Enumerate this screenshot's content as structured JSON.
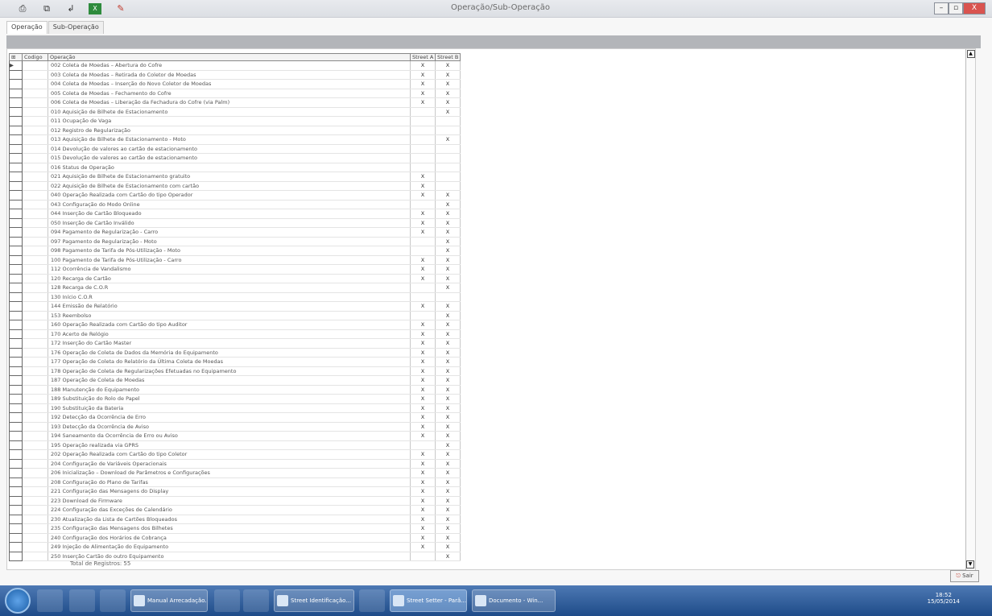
{
  "window": {
    "title": "Operação/Sub-Operação",
    "toolbar_icons": [
      "print-icon",
      "copy-icon",
      "export-icon",
      "excel-icon",
      "pdf-icon"
    ],
    "controls": {
      "minimize": "–",
      "maximize": "▫",
      "close": "X"
    }
  },
  "tabs": [
    {
      "label": "Operação"
    },
    {
      "label": "Sub-Operação"
    }
  ],
  "banner": "",
  "grid": {
    "headers": {
      "select": "",
      "code": "Codigo",
      "operation": "Operação",
      "streetA": "Street A",
      "streetB": "Street B"
    },
    "rows": [
      {
        "op": "002 Coleta de Moedas – Abertura do Cofre",
        "a": "X",
        "b": "X"
      },
      {
        "op": "003 Coleta de Moedas – Retirada do Coletor de Moedas",
        "a": "X",
        "b": "X"
      },
      {
        "op": "004 Coleta de Moedas – Inserção do Novo Coletor de Moedas",
        "a": "X",
        "b": "X"
      },
      {
        "op": "005 Coleta de Moedas – Fechamento do Cofre",
        "a": "X",
        "b": "X"
      },
      {
        "op": "006 Coleta de Moedas – Liberação da Fechadura do Cofre (via Palm)",
        "a": "X",
        "b": "X"
      },
      {
        "op": "010 Aquisição de Bilhete de Estacionamento",
        "a": "",
        "b": "X"
      },
      {
        "op": "011 Ocupação de Vaga",
        "a": "",
        "b": ""
      },
      {
        "op": "012 Registro de Regularização",
        "a": "",
        "b": ""
      },
      {
        "op": "013 Aquisição de Bilhete de Estacionamento - Moto",
        "a": "",
        "b": "X"
      },
      {
        "op": "014 Devolução de valores ao cartão de estacionamento",
        "a": "",
        "b": ""
      },
      {
        "op": "015 Devolução de valores ao cartão de estacionamento",
        "a": "",
        "b": ""
      },
      {
        "op": "016 Status de Operação",
        "a": "",
        "b": ""
      },
      {
        "op": "021 Aquisição de Bilhete de Estacionamento gratuito",
        "a": "X",
        "b": ""
      },
      {
        "op": "022 Aquisição de Bilhete de Estacionamento com cartão",
        "a": "X",
        "b": ""
      },
      {
        "op": "040 Operação Realizada com Cartão do tipo Operador",
        "a": "X",
        "b": "X"
      },
      {
        "op": "043 Configuração do Modo Online",
        "a": "",
        "b": "X"
      },
      {
        "op": "044 Inserção de Cartão Bloqueado",
        "a": "X",
        "b": "X"
      },
      {
        "op": "050 Inserção de Cartão Inválido",
        "a": "X",
        "b": "X"
      },
      {
        "op": "094 Pagamento de Regularização - Carro",
        "a": "X",
        "b": "X"
      },
      {
        "op": "097 Pagamento de Regularização - Moto",
        "a": "",
        "b": "X"
      },
      {
        "op": "098 Pagamento de Tarifa de Pós-Utilização - Moto",
        "a": "",
        "b": "X"
      },
      {
        "op": "100 Pagamento de Tarifa de Pós-Utilização - Carro",
        "a": "X",
        "b": "X"
      },
      {
        "op": "112 Ocorrência de Vandalismo",
        "a": "X",
        "b": "X"
      },
      {
        "op": "120 Recarga de Cartão",
        "a": "X",
        "b": "X"
      },
      {
        "op": "128 Recarga de C.O.R",
        "a": "",
        "b": "X"
      },
      {
        "op": "130 Início C.O.R",
        "a": "",
        "b": ""
      },
      {
        "op": "144 Emissão de Relatório",
        "a": "X",
        "b": "X"
      },
      {
        "op": "153 Reembolso",
        "a": "",
        "b": "X"
      },
      {
        "op": "160 Operação Realizada com Cartão do tipo Auditor",
        "a": "X",
        "b": "X"
      },
      {
        "op": "170 Acerto de Relógio",
        "a": "X",
        "b": "X"
      },
      {
        "op": "172 Inserção do Cartão Master",
        "a": "X",
        "b": "X"
      },
      {
        "op": "176 Operação de Coleta de Dados da Memória do Equipamento",
        "a": "X",
        "b": "X"
      },
      {
        "op": "177 Operação de Coleta do Relatório da Última Coleta de Moedas",
        "a": "X",
        "b": "X"
      },
      {
        "op": "178 Operação de Coleta de Regularizações Efetuadas no Equipamento",
        "a": "X",
        "b": "X"
      },
      {
        "op": "187 Operação de Coleta de Moedas",
        "a": "X",
        "b": "X"
      },
      {
        "op": "188 Manutenção do Equipamento",
        "a": "X",
        "b": "X"
      },
      {
        "op": "189 Substituição do Rolo de Papel",
        "a": "X",
        "b": "X"
      },
      {
        "op": "190 Substituição da Bateria",
        "a": "X",
        "b": "X"
      },
      {
        "op": "192 Detecção da Ocorrência de Erro",
        "a": "X",
        "b": "X"
      },
      {
        "op": "193 Detecção da Ocorrência de Aviso",
        "a": "X",
        "b": "X"
      },
      {
        "op": "194 Saneamento da Ocorrência de Erro ou Aviso",
        "a": "X",
        "b": "X"
      },
      {
        "op": "195 Operação realizada via GPRS",
        "a": "",
        "b": "X"
      },
      {
        "op": "202 Operação Realizada com Cartão do tipo Coletor",
        "a": "X",
        "b": "X"
      },
      {
        "op": "204 Configuração de Variáveis Operacionais",
        "a": "X",
        "b": "X"
      },
      {
        "op": "206 Inicialização – Download de Parâmetros e Configurações",
        "a": "X",
        "b": "X"
      },
      {
        "op": "208 Configuração do Plano de Tarifas",
        "a": "X",
        "b": "X"
      },
      {
        "op": "221 Configuração das Mensagens do Display",
        "a": "X",
        "b": "X"
      },
      {
        "op": "223 Download de Firmware",
        "a": "X",
        "b": "X"
      },
      {
        "op": "224 Configuração das Exceções de Calendário",
        "a": "X",
        "b": "X"
      },
      {
        "op": "230 Atualização da Lista de Cartões Bloqueados",
        "a": "X",
        "b": "X"
      },
      {
        "op": "235 Configuração das Mensagens dos Bilhetes",
        "a": "X",
        "b": "X"
      },
      {
        "op": "240 Configuração dos Horários de Cobrança",
        "a": "X",
        "b": "X"
      },
      {
        "op": "249 Injeção de Alimentação do Equipamento",
        "a": "X",
        "b": "X"
      },
      {
        "op": "250 Inserção Cartão do outro Equipamento",
        "a": "",
        "b": "X"
      }
    ],
    "total": "Total de Registros: 55"
  },
  "sair_button": "Sair",
  "taskbar": {
    "windows": [
      {
        "label": "Manual Arrecadação..."
      },
      {
        "label": "Street Identificação..."
      },
      {
        "label": "Street Setter - Parâ..."
      },
      {
        "label": "Documento - Win..."
      }
    ],
    "clock": {
      "time": "18:52",
      "date": "15/05/2014"
    }
  }
}
